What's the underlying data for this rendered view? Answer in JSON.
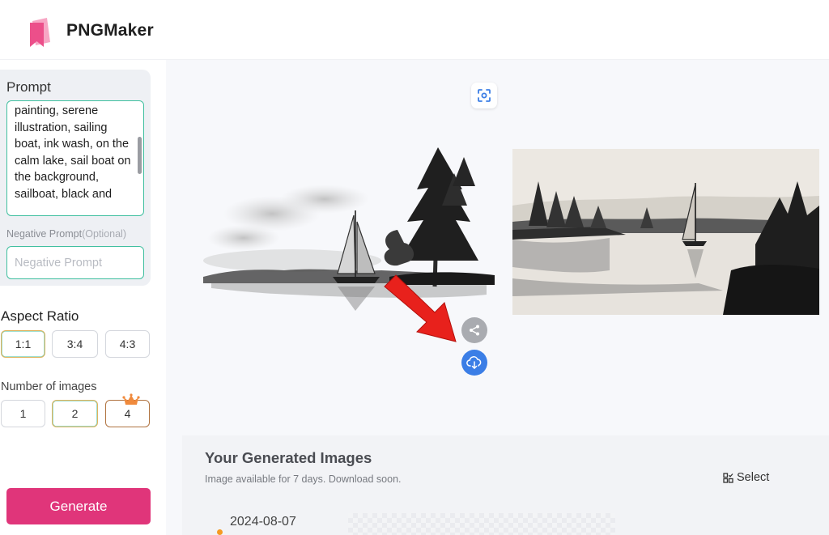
{
  "app": {
    "name": "PNGMaker"
  },
  "sidebar": {
    "prompt_label": "Prompt",
    "prompt_text": "painting, serene illustration, sailing boat, ink wash, on the calm lake, sail boat on the background, sailboat, black and",
    "negative_label": "Negative Prompt",
    "negative_optional": "(Optional)",
    "negative_placeholder": "Negative Prompt",
    "aspect_label": "Aspect Ratio",
    "aspect_options": [
      "1:1",
      "3:4",
      "4:3"
    ],
    "aspect_selected": "1:1",
    "number_label": "Number of images",
    "number_options": [
      "1",
      "2",
      "4"
    ],
    "number_selected": "2",
    "generate_label": "Generate"
  },
  "main": {
    "scan_icon": "scan-icon",
    "share_icon": "share-icon",
    "download_icon": "cloud-download-icon",
    "generated_title": "Your Generated Images",
    "generated_sub": "Image available for 7 days. Download soon.",
    "select_label": "Select",
    "date": "2024-08-07"
  },
  "colors": {
    "accent_pink": "#e0357a",
    "accent_teal": "#3fbf9f",
    "download_blue": "#3b7ee6",
    "dot_orange": "#f59a23",
    "arrow_red": "#e8211c"
  }
}
